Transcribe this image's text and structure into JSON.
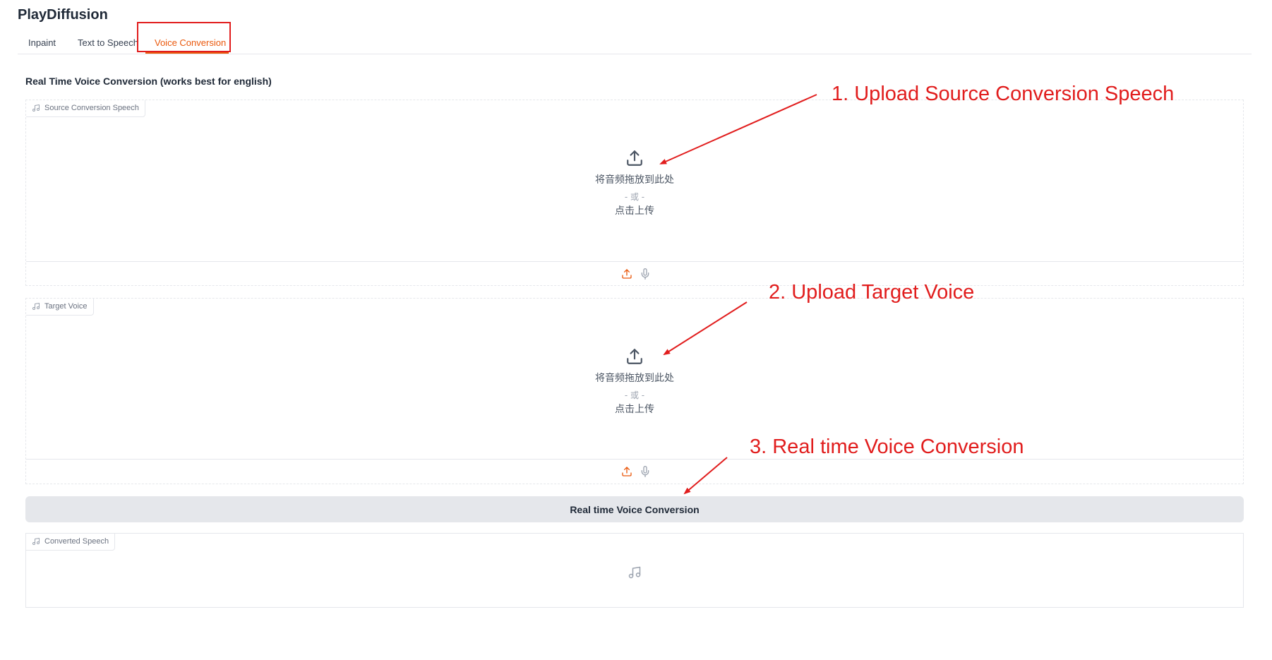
{
  "app": {
    "title": "PlayDiffusion"
  },
  "tabs": [
    {
      "label": "Inpaint",
      "active": false
    },
    {
      "label": "Text to Speech",
      "active": false
    },
    {
      "label": "Voice Conversion",
      "active": true
    }
  ],
  "section": {
    "heading": "Real Time Voice Conversion (works best for english)"
  },
  "source_panel": {
    "label": "Source Conversion Speech",
    "drop_text": "将音频拖放到此处",
    "or_text": "- 或 -",
    "click_text": "点击上传"
  },
  "target_panel": {
    "label": "Target Voice",
    "drop_text": "将音频拖放到此处",
    "or_text": "- 或 -",
    "click_text": "点击上传"
  },
  "convert_button": {
    "label": "Real time Voice Conversion"
  },
  "output_panel": {
    "label": "Converted Speech"
  },
  "annotations": [
    {
      "text": "1. Upload Source Conversion Speech"
    },
    {
      "text": "2. Upload Target Voice"
    },
    {
      "text": "3. Real time Voice Conversion"
    }
  ],
  "colors": {
    "accent": "#ea580c",
    "annotation": "#e11d1d",
    "button_bg": "#e5e7eb",
    "border": "#e5e7eb"
  },
  "icons": {
    "panel_label": "music-note-icon",
    "dropzone": "upload-icon",
    "toolbar_upload": "upload-icon",
    "toolbar_record": "microphone-icon",
    "output_placeholder": "music-note-icon"
  }
}
